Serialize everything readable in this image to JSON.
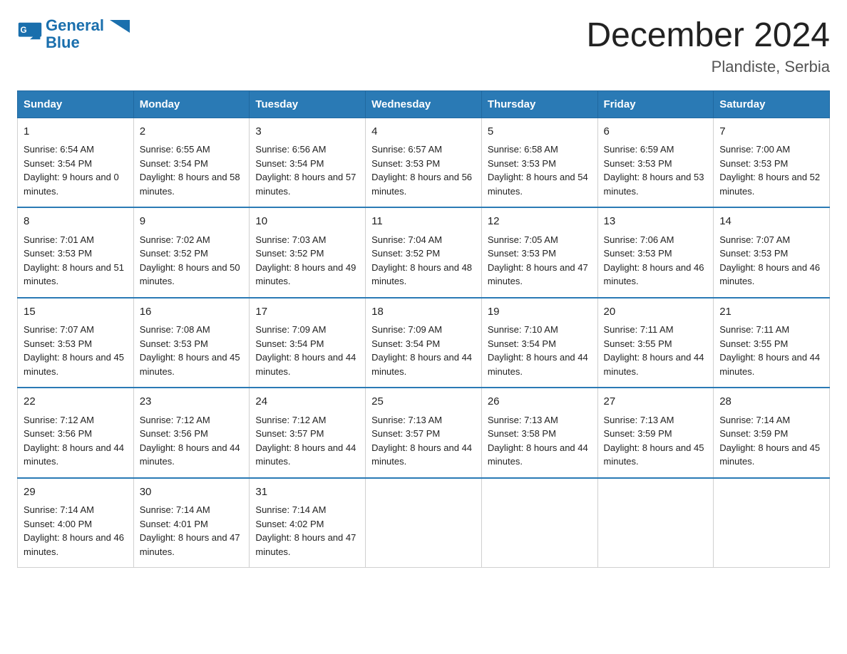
{
  "header": {
    "logo_line1": "General",
    "logo_line2": "Blue",
    "title": "December 2024",
    "subtitle": "Plandiste, Serbia"
  },
  "columns": [
    "Sunday",
    "Monday",
    "Tuesday",
    "Wednesday",
    "Thursday",
    "Friday",
    "Saturday"
  ],
  "weeks": [
    [
      {
        "day": "1",
        "sunrise": "Sunrise: 6:54 AM",
        "sunset": "Sunset: 3:54 PM",
        "daylight": "Daylight: 9 hours and 0 minutes."
      },
      {
        "day": "2",
        "sunrise": "Sunrise: 6:55 AM",
        "sunset": "Sunset: 3:54 PM",
        "daylight": "Daylight: 8 hours and 58 minutes."
      },
      {
        "day": "3",
        "sunrise": "Sunrise: 6:56 AM",
        "sunset": "Sunset: 3:54 PM",
        "daylight": "Daylight: 8 hours and 57 minutes."
      },
      {
        "day": "4",
        "sunrise": "Sunrise: 6:57 AM",
        "sunset": "Sunset: 3:53 PM",
        "daylight": "Daylight: 8 hours and 56 minutes."
      },
      {
        "day": "5",
        "sunrise": "Sunrise: 6:58 AM",
        "sunset": "Sunset: 3:53 PM",
        "daylight": "Daylight: 8 hours and 54 minutes."
      },
      {
        "day": "6",
        "sunrise": "Sunrise: 6:59 AM",
        "sunset": "Sunset: 3:53 PM",
        "daylight": "Daylight: 8 hours and 53 minutes."
      },
      {
        "day": "7",
        "sunrise": "Sunrise: 7:00 AM",
        "sunset": "Sunset: 3:53 PM",
        "daylight": "Daylight: 8 hours and 52 minutes."
      }
    ],
    [
      {
        "day": "8",
        "sunrise": "Sunrise: 7:01 AM",
        "sunset": "Sunset: 3:53 PM",
        "daylight": "Daylight: 8 hours and 51 minutes."
      },
      {
        "day": "9",
        "sunrise": "Sunrise: 7:02 AM",
        "sunset": "Sunset: 3:52 PM",
        "daylight": "Daylight: 8 hours and 50 minutes."
      },
      {
        "day": "10",
        "sunrise": "Sunrise: 7:03 AM",
        "sunset": "Sunset: 3:52 PM",
        "daylight": "Daylight: 8 hours and 49 minutes."
      },
      {
        "day": "11",
        "sunrise": "Sunrise: 7:04 AM",
        "sunset": "Sunset: 3:52 PM",
        "daylight": "Daylight: 8 hours and 48 minutes."
      },
      {
        "day": "12",
        "sunrise": "Sunrise: 7:05 AM",
        "sunset": "Sunset: 3:53 PM",
        "daylight": "Daylight: 8 hours and 47 minutes."
      },
      {
        "day": "13",
        "sunrise": "Sunrise: 7:06 AM",
        "sunset": "Sunset: 3:53 PM",
        "daylight": "Daylight: 8 hours and 46 minutes."
      },
      {
        "day": "14",
        "sunrise": "Sunrise: 7:07 AM",
        "sunset": "Sunset: 3:53 PM",
        "daylight": "Daylight: 8 hours and 46 minutes."
      }
    ],
    [
      {
        "day": "15",
        "sunrise": "Sunrise: 7:07 AM",
        "sunset": "Sunset: 3:53 PM",
        "daylight": "Daylight: 8 hours and 45 minutes."
      },
      {
        "day": "16",
        "sunrise": "Sunrise: 7:08 AM",
        "sunset": "Sunset: 3:53 PM",
        "daylight": "Daylight: 8 hours and 45 minutes."
      },
      {
        "day": "17",
        "sunrise": "Sunrise: 7:09 AM",
        "sunset": "Sunset: 3:54 PM",
        "daylight": "Daylight: 8 hours and 44 minutes."
      },
      {
        "day": "18",
        "sunrise": "Sunrise: 7:09 AM",
        "sunset": "Sunset: 3:54 PM",
        "daylight": "Daylight: 8 hours and 44 minutes."
      },
      {
        "day": "19",
        "sunrise": "Sunrise: 7:10 AM",
        "sunset": "Sunset: 3:54 PM",
        "daylight": "Daylight: 8 hours and 44 minutes."
      },
      {
        "day": "20",
        "sunrise": "Sunrise: 7:11 AM",
        "sunset": "Sunset: 3:55 PM",
        "daylight": "Daylight: 8 hours and 44 minutes."
      },
      {
        "day": "21",
        "sunrise": "Sunrise: 7:11 AM",
        "sunset": "Sunset: 3:55 PM",
        "daylight": "Daylight: 8 hours and 44 minutes."
      }
    ],
    [
      {
        "day": "22",
        "sunrise": "Sunrise: 7:12 AM",
        "sunset": "Sunset: 3:56 PM",
        "daylight": "Daylight: 8 hours and 44 minutes."
      },
      {
        "day": "23",
        "sunrise": "Sunrise: 7:12 AM",
        "sunset": "Sunset: 3:56 PM",
        "daylight": "Daylight: 8 hours and 44 minutes."
      },
      {
        "day": "24",
        "sunrise": "Sunrise: 7:12 AM",
        "sunset": "Sunset: 3:57 PM",
        "daylight": "Daylight: 8 hours and 44 minutes."
      },
      {
        "day": "25",
        "sunrise": "Sunrise: 7:13 AM",
        "sunset": "Sunset: 3:57 PM",
        "daylight": "Daylight: 8 hours and 44 minutes."
      },
      {
        "day": "26",
        "sunrise": "Sunrise: 7:13 AM",
        "sunset": "Sunset: 3:58 PM",
        "daylight": "Daylight: 8 hours and 44 minutes."
      },
      {
        "day": "27",
        "sunrise": "Sunrise: 7:13 AM",
        "sunset": "Sunset: 3:59 PM",
        "daylight": "Daylight: 8 hours and 45 minutes."
      },
      {
        "day": "28",
        "sunrise": "Sunrise: 7:14 AM",
        "sunset": "Sunset: 3:59 PM",
        "daylight": "Daylight: 8 hours and 45 minutes."
      }
    ],
    [
      {
        "day": "29",
        "sunrise": "Sunrise: 7:14 AM",
        "sunset": "Sunset: 4:00 PM",
        "daylight": "Daylight: 8 hours and 46 minutes."
      },
      {
        "day": "30",
        "sunrise": "Sunrise: 7:14 AM",
        "sunset": "Sunset: 4:01 PM",
        "daylight": "Daylight: 8 hours and 47 minutes."
      },
      {
        "day": "31",
        "sunrise": "Sunrise: 7:14 AM",
        "sunset": "Sunset: 4:02 PM",
        "daylight": "Daylight: 8 hours and 47 minutes."
      },
      null,
      null,
      null,
      null
    ]
  ]
}
